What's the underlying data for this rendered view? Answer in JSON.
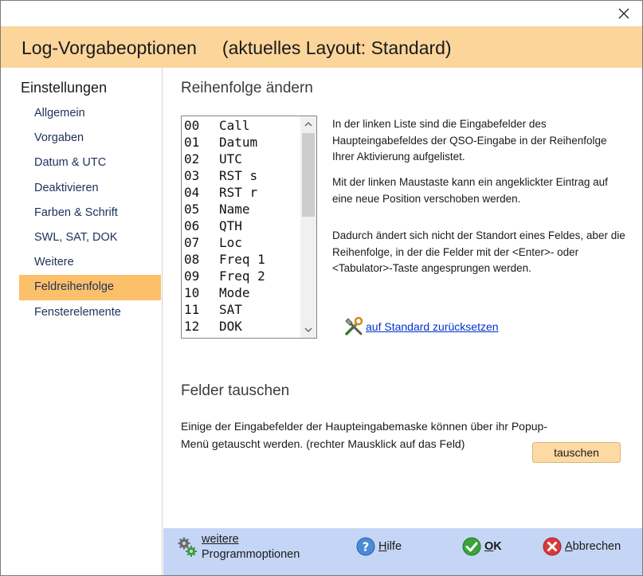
{
  "window": {
    "close_glyph": "✕"
  },
  "header": {
    "title": "Log-Vorgabeoptionen     (aktuelles Layout: Standard)"
  },
  "sidebar": {
    "heading": "Einstellungen",
    "items": [
      {
        "label": "Allgemein"
      },
      {
        "label": "Vorgaben"
      },
      {
        "label": "Datum & UTC"
      },
      {
        "label": "Deaktivieren"
      },
      {
        "label": "Farben & Schrift"
      },
      {
        "label": "SWL, SAT, DOK"
      },
      {
        "label": "Weitere"
      },
      {
        "label": "Feldreihenfolge",
        "active": true
      },
      {
        "label": "Fensterelemente"
      }
    ]
  },
  "order_section": {
    "title": "Reihenfolge ändern",
    "list": [
      {
        "num": "00",
        "name": "Call"
      },
      {
        "num": "01",
        "name": "Datum"
      },
      {
        "num": "02",
        "name": "UTC"
      },
      {
        "num": "03",
        "name": "RST s"
      },
      {
        "num": "04",
        "name": "RST r"
      },
      {
        "num": "05",
        "name": "Name"
      },
      {
        "num": "06",
        "name": "QTH"
      },
      {
        "num": "07",
        "name": "Loc"
      },
      {
        "num": "08",
        "name": "Freq 1"
      },
      {
        "num": "09",
        "name": "Freq 2"
      },
      {
        "num": "10",
        "name": "Mode"
      },
      {
        "num": "11",
        "name": "SAT"
      },
      {
        "num": "12",
        "name": "DOK"
      }
    ],
    "desc1": "In der linken Liste sind die Eingabefelder des Haupteingabefeldes der QSO-Eingabe in der Reihenfolge Ihrer Aktivierung aufgelistet.",
    "desc2": "Mit der linken Maustaste  kann ein angeklickter Eintrag auf eine neue Position verschoben werden.",
    "desc3": "Dadurch ändert sich nicht der Standort eines Feldes, aber die Reihenfolge, in der die Felder mit der <Enter>- oder <Tabulator>-Taste angesprungen werden.",
    "reset_link": "auf Standard zurücksetzen"
  },
  "swap_section": {
    "title": "Felder tauschen",
    "text": "Einige der Eingabefelder der Haupteingabemaske können über ihr Popup-Menü getauscht werden. (rechter Mausklick auf das Feld)",
    "button": "tauschen"
  },
  "footer": {
    "more_options_line1": "weitere",
    "more_options_line2": "Programmoptionen",
    "help_first": "H",
    "help_rest": "ilfe",
    "ok_first": "O",
    "ok_rest": "K",
    "cancel_first": "A",
    "cancel_rest": "bbrechen"
  }
}
